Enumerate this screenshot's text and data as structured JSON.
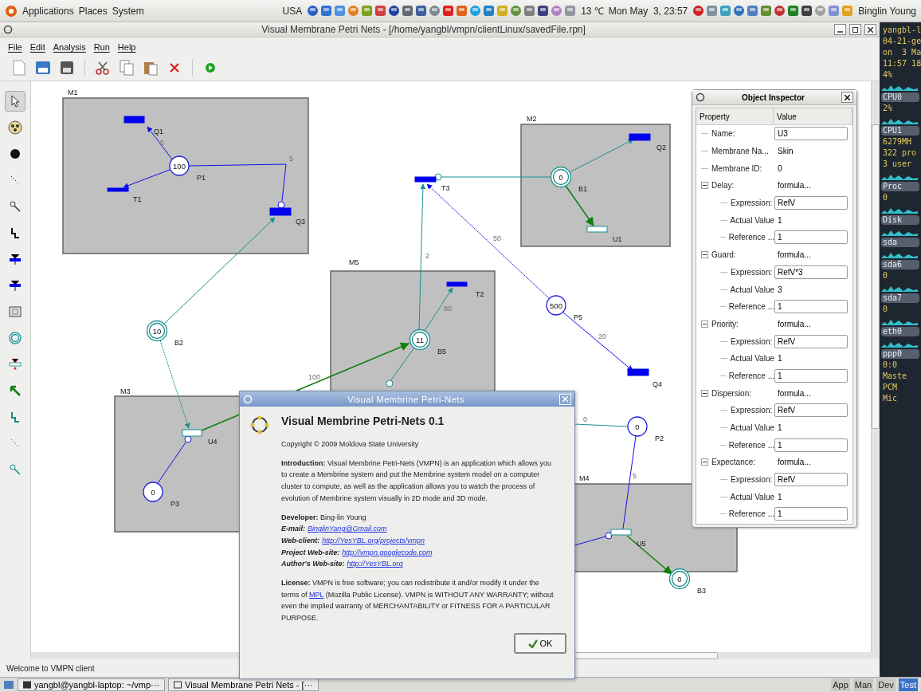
{
  "top_panel": {
    "menus": [
      "Applications",
      "Places",
      "System"
    ],
    "region": "USA",
    "temperature": "13 ℃",
    "clock": "Mon May  3, 23:57",
    "user": "Binglin Young"
  },
  "window": {
    "title": "Visual Membrane Petri Nets - [/home/yangbl/vmpn/clientLinux/savedFile.rpn]",
    "menu": [
      "File",
      "Edit",
      "Analysis",
      "Run",
      "Help"
    ]
  },
  "toolbox": [
    {
      "selected": true
    },
    {
      "selected": false
    },
    {
      "selected": false
    },
    {
      "selected": false
    },
    {
      "selected": false
    },
    {
      "selected": false
    },
    {
      "selected": false
    },
    {
      "selected": false
    },
    {
      "selected": false
    },
    {
      "selected": false
    },
    {
      "selected": false
    },
    {
      "selected": false
    },
    {
      "selected": false
    },
    {
      "selected": false
    },
    {
      "selected": false
    }
  ],
  "canvas": {
    "membranes": [
      "M1",
      "M2",
      "M5",
      "M3",
      "M4"
    ],
    "places": [
      {
        "label": "P1",
        "tokens": "100",
        "kind": "place"
      },
      {
        "label": "B2",
        "tokens": "10",
        "kind": "bag"
      },
      {
        "label": "P3",
        "tokens": "0",
        "kind": "place"
      },
      {
        "label": "B1",
        "tokens": "0",
        "kind": "bag"
      },
      {
        "label": "B5",
        "tokens": "11",
        "kind": "bag"
      },
      {
        "label": "P5",
        "tokens": "500",
        "kind": "place"
      },
      {
        "label": "P2",
        "tokens": "0",
        "kind": "place"
      },
      {
        "label": "B3",
        "tokens": "0",
        "kind": "bag"
      }
    ],
    "transitions": [
      {
        "label": "Q1",
        "kind": "filled"
      },
      {
        "label": "T1",
        "kind": "filled"
      },
      {
        "label": "Q3",
        "kind": "filled"
      },
      {
        "label": "T3",
        "kind": "filled"
      },
      {
        "label": "Q2",
        "kind": "filled"
      },
      {
        "label": "U1",
        "kind": "hollow"
      },
      {
        "label": "T2",
        "kind": "filled"
      },
      {
        "label": "Q4",
        "kind": "filled"
      },
      {
        "label": "U4",
        "kind": "hollow"
      },
      {
        "label": "U5",
        "kind": "hollow"
      }
    ],
    "arc_weights": [
      "5",
      "5",
      "50",
      "2",
      "80",
      "20",
      "100",
      "0",
      "5"
    ]
  },
  "status_bar": "Welcome to VMPN client",
  "inspector": {
    "title": "Object Inspector",
    "columns": [
      "Property",
      "Value"
    ],
    "rows": [
      {
        "label": "Name:",
        "value": "U3",
        "kind": "field"
      },
      {
        "label": "Membrane Na...",
        "value": "Skin",
        "kind": "text"
      },
      {
        "label": "Membrane ID:",
        "value": "0",
        "kind": "text"
      },
      {
        "label": "Delay:",
        "value": "formula...",
        "kind": "text",
        "expanded": true,
        "children": [
          {
            "label": "Expression:",
            "value": "RefV",
            "kind": "field"
          },
          {
            "label": "Actual Value",
            "value": "1",
            "kind": "text"
          },
          {
            "label": "Reference ...",
            "value": "1",
            "kind": "field"
          }
        ]
      },
      {
        "label": "Guard:",
        "value": "formula...",
        "kind": "text",
        "expanded": true,
        "children": [
          {
            "label": "Expression:",
            "value": "RefV*3",
            "kind": "field"
          },
          {
            "label": "Actual Value",
            "value": "3",
            "kind": "text"
          },
          {
            "label": "Reference ...",
            "value": "1",
            "kind": "field"
          }
        ]
      },
      {
        "label": "Priority:",
        "value": "formula...",
        "kind": "text",
        "expanded": true,
        "children": [
          {
            "label": "Expression:",
            "value": "RefV",
            "kind": "field"
          },
          {
            "label": "Actual Value",
            "value": "1",
            "kind": "text"
          },
          {
            "label": "Reference ...",
            "value": "1",
            "kind": "field"
          }
        ]
      },
      {
        "label": "Dispersion:",
        "value": "formula...",
        "kind": "text",
        "expanded": true,
        "children": [
          {
            "label": "Expression:",
            "value": "RefV",
            "kind": "field"
          },
          {
            "label": "Actual Value",
            "value": "1",
            "kind": "text"
          },
          {
            "label": "Reference ...",
            "value": "1",
            "kind": "field"
          }
        ]
      },
      {
        "label": "Expectance:",
        "value": "formula...",
        "kind": "text",
        "expanded": true,
        "children": [
          {
            "label": "Expression:",
            "value": "RefV",
            "kind": "field"
          },
          {
            "label": "Actual Value",
            "value": "1",
            "kind": "text"
          },
          {
            "label": "Reference ...",
            "value": "1",
            "kind": "field"
          }
        ]
      }
    ]
  },
  "about": {
    "title": "Visual Membrine Petri-Nets",
    "heading": "Visual Membrine Petri-Nets 0.1",
    "copyright": "Copyright © 2009 Moldova State University",
    "intro": "**Introduction:** Visual Membrine Petri-Nets (VMPN) is an application which allows you to create a Membrine system and put the Membrine system model on a computer cluster to compute, as well as the application allows you to watch the process of evolution of Membrine system visually in 2D mode and 3D mode.",
    "developer": "**Developer:** Bing-lin Young",
    "links": [
      {
        "label": "E-mail:",
        "url": "BinglinYang@Gmail.com"
      },
      {
        "label": "Web-client:",
        "url": "http://YesYBL.org/projects/vmpn"
      },
      {
        "label": "Project Web-site:",
        "url": "http://vmpn.googlecode.com"
      },
      {
        "label": "Author's Web-site:",
        "url": "http://YesYBL.org"
      }
    ],
    "license_before": "**License:** VMPN is free software; you can redistribute it and/or modify it under the terms of",
    "license_link": "MPL",
    "license_after": "(Mozilla Public License). VMPN is WITHOUT ANY WARRANTY; without even the implied warranty of MERCHANTABILITY or FITNESS FOR A PARTICULAR PURPOSE.",
    "ok": "OK"
  },
  "sysmon": [
    {
      "text": "yangbl-l",
      "kind": "value"
    },
    {
      "text": "04-21-ge",
      "kind": "value"
    },
    {
      "text": "on  3 Ma",
      "kind": "value"
    },
    {
      "text": "11:57 18",
      "kind": "value"
    },
    {
      "text": "4%",
      "kind": "value"
    },
    {
      "text": "CPU0",
      "kind": "title"
    },
    {
      "text": "2%",
      "kind": "value"
    },
    {
      "text": "CPU1",
      "kind": "title"
    },
    {
      "text": "6279MH",
      "kind": "value"
    },
    {
      "text": "322 pro",
      "kind": "value"
    },
    {
      "text": "3 user",
      "kind": "value"
    },
    {
      "text": "Proc",
      "kind": "title"
    },
    {
      "text": "0",
      "kind": "value"
    },
    {
      "text": "Disk",
      "kind": "title"
    },
    {
      "text": "sda",
      "kind": "title"
    },
    {
      "text": "sda6",
      "kind": "title"
    },
    {
      "text": "0",
      "kind": "value"
    },
    {
      "text": "sda7",
      "kind": "title"
    },
    {
      "text": "0",
      "kind": "value"
    },
    {
      "text": "eth0",
      "kind": "title"
    },
    {
      "text": "ppp0",
      "kind": "title"
    },
    {
      "text": "0:0",
      "kind": "value"
    },
    {
      "text": "Maste",
      "kind": "value"
    },
    {
      "text": "PCM",
      "kind": "value"
    },
    {
      "text": "Mic",
      "kind": "value"
    }
  ],
  "taskbar": {
    "tasks": [
      "yangbl@yangbl-laptop: ~/vmp···",
      "Visual Membrane Petri Nets - [···"
    ],
    "workspaces": [
      {
        "label": "App",
        "selected": false
      },
      {
        "label": "Man",
        "selected": false
      },
      {
        "label": "Dev",
        "selected": false
      },
      {
        "label": "Test",
        "selected": true
      }
    ]
  }
}
